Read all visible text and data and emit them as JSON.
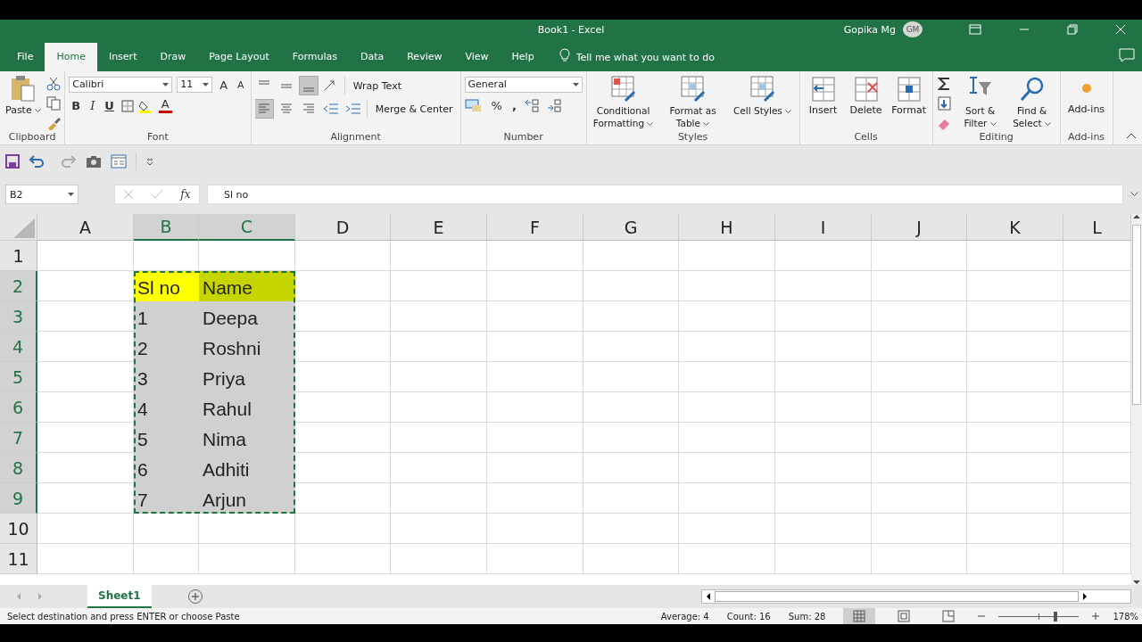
{
  "title_bar": {
    "title": "Book1  -  Excel",
    "user": "Gopika Mg",
    "avatar": "GM"
  },
  "tabs": [
    {
      "label": "File",
      "selected": false
    },
    {
      "label": "Home",
      "selected": true
    },
    {
      "label": "Insert",
      "selected": false
    },
    {
      "label": "Draw",
      "selected": false
    },
    {
      "label": "Page Layout",
      "selected": false
    },
    {
      "label": "Formulas",
      "selected": false
    },
    {
      "label": "Data",
      "selected": false
    },
    {
      "label": "Review",
      "selected": false
    },
    {
      "label": "View",
      "selected": false
    },
    {
      "label": "Help",
      "selected": false
    }
  ],
  "tell_me": {
    "placeholder": "Tell me what you want to do"
  },
  "ribbon": {
    "clipboard": {
      "label": "Clipboard",
      "paste": "Paste"
    },
    "font": {
      "label": "Font",
      "font_name": "Calibri",
      "font_size": "11",
      "grow": "A",
      "shrink": "A",
      "bold": "B",
      "italic": "I",
      "underline": "U",
      "font_color": "A"
    },
    "alignment": {
      "label": "Alignment",
      "wrap_text": "Wrap Text",
      "merge": "Merge & Center",
      "vertical_align": [
        {
          "selected": false
        },
        {
          "selected": false
        },
        {
          "selected": true
        }
      ],
      "horizontal_align": [
        {
          "selected": true
        },
        {
          "selected": false
        },
        {
          "selected": false
        }
      ]
    },
    "number": {
      "label": "Number",
      "format": "General",
      "percent": "%",
      "comma": ","
    },
    "styles": {
      "label": "Styles",
      "buttons": [
        "Conditional Formatting",
        "Format as Table",
        "Cell Styles"
      ]
    },
    "cells": {
      "label": "Cells",
      "buttons": [
        "Insert",
        "Delete",
        "Format"
      ]
    },
    "editing": {
      "label": "Editing",
      "buttons": [
        "Sort & Filter",
        "Find & Select"
      ]
    },
    "addins": {
      "label": "Add-ins",
      "button": "Add-ins"
    }
  },
  "formula_bar": {
    "name_box": "B2",
    "function_symbol": "fx",
    "formula": "Sl no"
  },
  "sheet": {
    "columns": [
      {
        "label": "A",
        "selected": false
      },
      {
        "label": "B",
        "selected": true
      },
      {
        "label": "C",
        "selected": true
      },
      {
        "label": "D",
        "selected": false
      },
      {
        "label": "E",
        "selected": false
      },
      {
        "label": "F",
        "selected": false
      },
      {
        "label": "G",
        "selected": false
      },
      {
        "label": "H",
        "selected": false
      },
      {
        "label": "I",
        "selected": false
      },
      {
        "label": "J",
        "selected": false
      },
      {
        "label": "K",
        "selected": false
      },
      {
        "label": "L",
        "selected": false
      }
    ],
    "rows": [
      {
        "label": "1",
        "selected": false
      },
      {
        "label": "2",
        "selected": true
      },
      {
        "label": "3",
        "selected": true
      },
      {
        "label": "4",
        "selected": true
      },
      {
        "label": "5",
        "selected": true
      },
      {
        "label": "6",
        "selected": true
      },
      {
        "label": "7",
        "selected": true
      },
      {
        "label": "8",
        "selected": true
      },
      {
        "label": "9",
        "selected": true
      },
      {
        "label": "10",
        "selected": false
      },
      {
        "label": "11",
        "selected": false
      }
    ],
    "data": [
      {
        "cells": [
          {
            "text": "Sl no",
            "color": "#ffff00"
          },
          {
            "text": "Name",
            "color": "#c5d500"
          }
        ]
      },
      {
        "cells": [
          {
            "text": "1",
            "color": "#d0d0d0"
          },
          {
            "text": "Deepa",
            "color": "#d0d0d0"
          }
        ]
      },
      {
        "cells": [
          {
            "text": "2",
            "color": "#d0d0d0"
          },
          {
            "text": "Roshni",
            "color": "#d0d0d0"
          }
        ]
      },
      {
        "cells": [
          {
            "text": "3",
            "color": "#d0d0d0"
          },
          {
            "text": "Priya",
            "color": "#d0d0d0"
          }
        ]
      },
      {
        "cells": [
          {
            "text": "4",
            "color": "#d0d0d0"
          },
          {
            "text": "Rahul",
            "color": "#d0d0d0"
          }
        ]
      },
      {
        "cells": [
          {
            "text": "5",
            "color": "#d0d0d0"
          },
          {
            "text": "Nima",
            "color": "#d0d0d0"
          }
        ]
      },
      {
        "cells": [
          {
            "text": "6",
            "color": "#d0d0d0"
          },
          {
            "text": "Adhiti",
            "color": "#d0d0d0"
          }
        ]
      },
      {
        "cells": [
          {
            "text": "7",
            "color": "#d0d0d0"
          },
          {
            "text": "Arjun",
            "color": "#d0d0d0"
          }
        ]
      }
    ]
  },
  "sheet_tabs": [
    {
      "label": "Sheet1",
      "selected": true
    }
  ],
  "status_bar": {
    "message": "Select destination and press ENTER or choose Paste",
    "average": "Average: 4",
    "count": "Count: 16",
    "sum": "Sum: 28",
    "views": [
      {
        "selected": true
      },
      {
        "selected": false
      },
      {
        "selected": false
      }
    ],
    "zoom_slider": {
      "level": 0.71
    },
    "zoom": "178%"
  }
}
